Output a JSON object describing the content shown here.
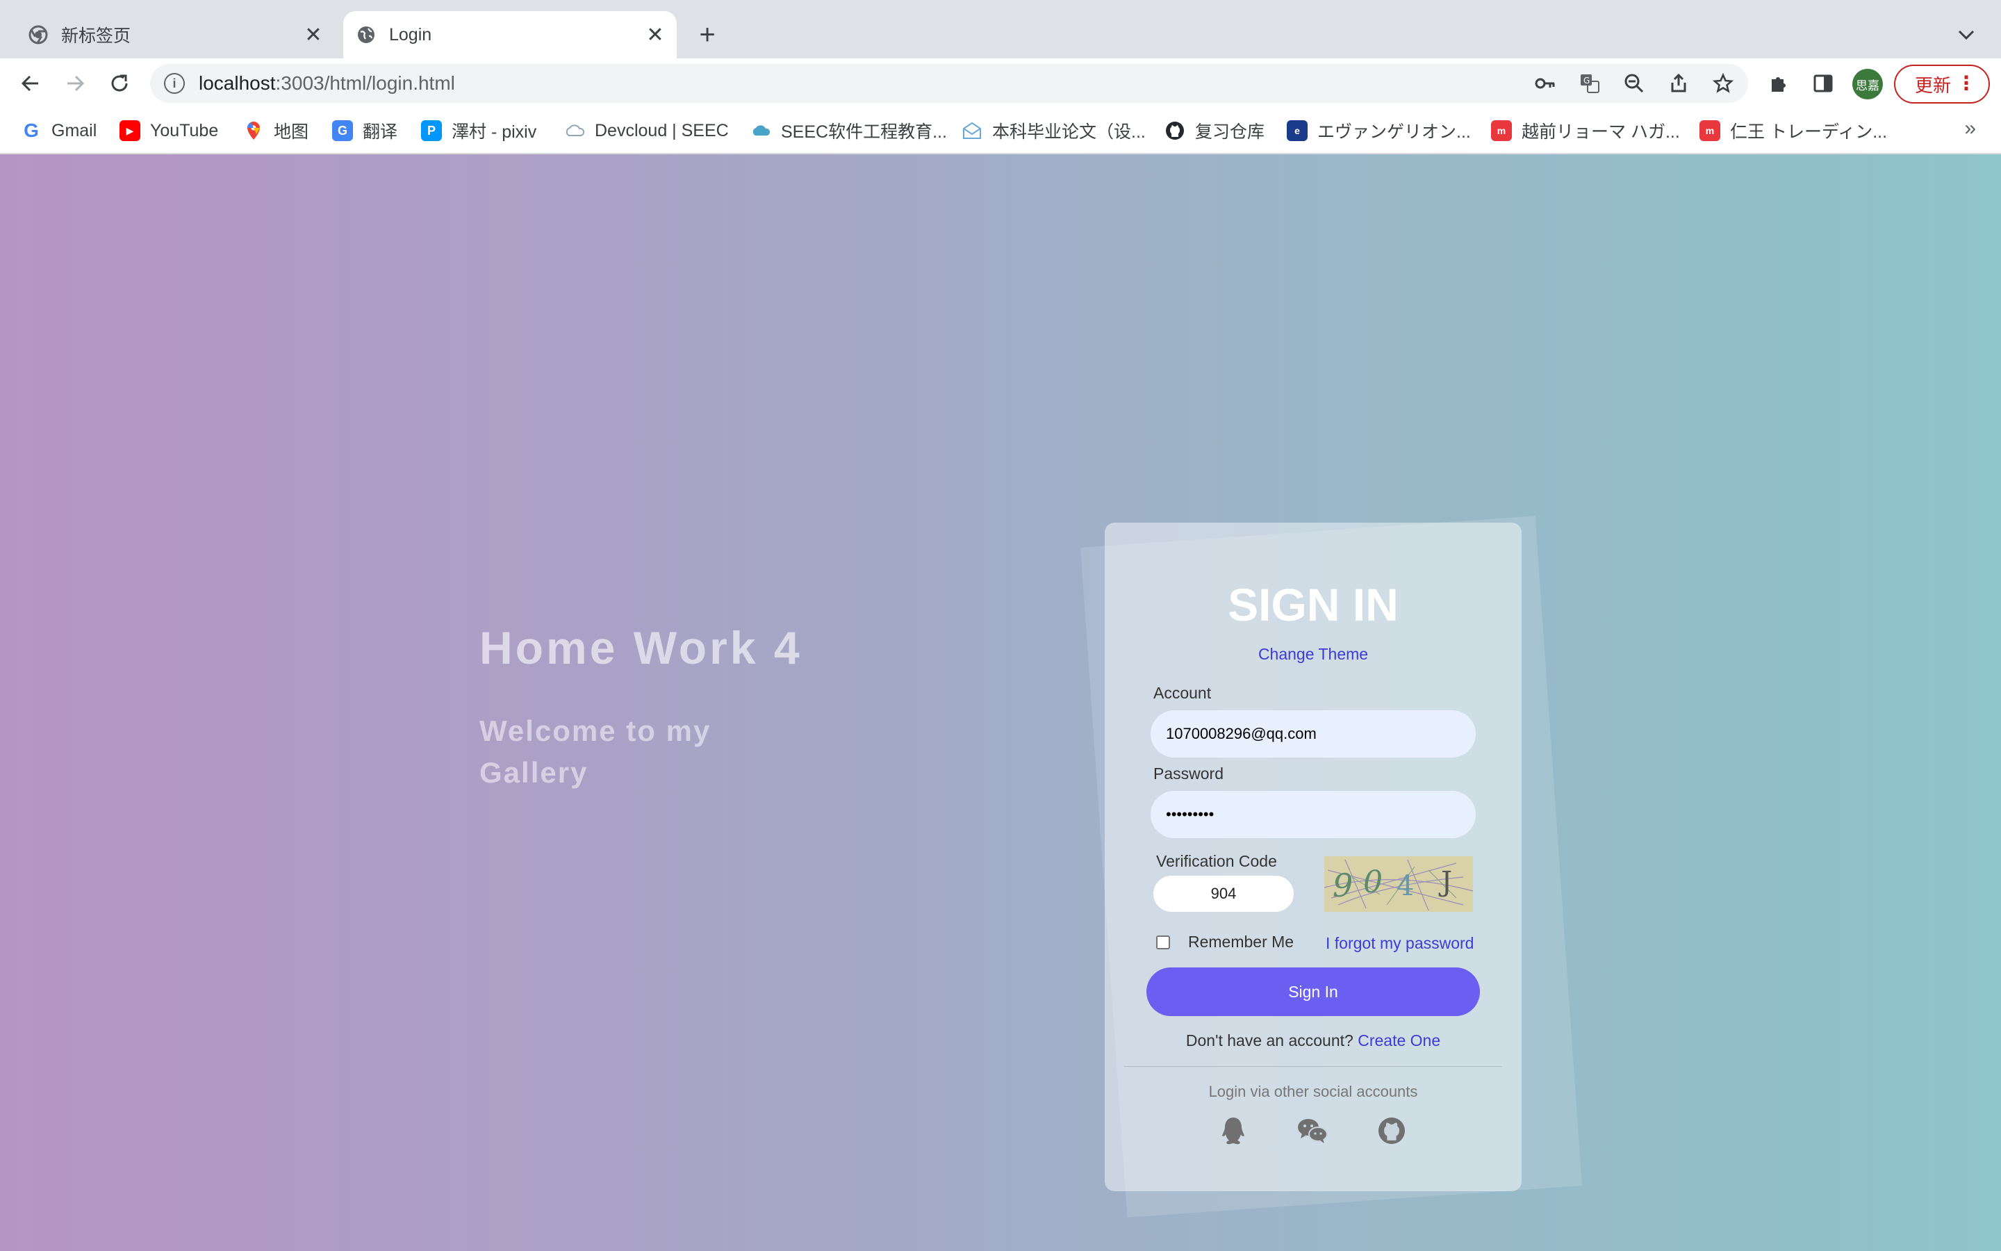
{
  "browser": {
    "tabs": [
      {
        "title": "新标签页",
        "icon": "chrome-icon",
        "active": false
      },
      {
        "title": "Login",
        "icon": "globe-icon",
        "active": true
      }
    ],
    "url_host": "localhost",
    "url_path": ":3003/html/login.html",
    "avatar_text": "思嘉",
    "update_label": "更新",
    "bookmarks": [
      {
        "label": "Gmail",
        "icon": "google-icon"
      },
      {
        "label": "YouTube",
        "icon": "youtube-icon"
      },
      {
        "label": "地图",
        "icon": "maps-icon"
      },
      {
        "label": "翻译",
        "icon": "translate-icon"
      },
      {
        "label": "澤村 - pixiv",
        "icon": "pixiv-icon"
      },
      {
        "label": "Devcloud | SEEC",
        "icon": "cloud-icon"
      },
      {
        "label": "SEEC软件工程教育...",
        "icon": "cloud-icon"
      },
      {
        "label": "本科毕业论文（设...",
        "icon": "mail-icon"
      },
      {
        "label": "复习仓库",
        "icon": "github-icon"
      },
      {
        "label": "エヴァンゲリオン...",
        "icon": "site-icon"
      },
      {
        "label": "越前リョーマ ハガ...",
        "icon": "shop-icon"
      },
      {
        "label": "仁王 トレーディン...",
        "icon": "shop-icon"
      }
    ],
    "more_label": "»"
  },
  "page": {
    "hero_title": "Home Work 4",
    "hero_subtitle": "Welcome to my Gallery"
  },
  "login": {
    "title": "SIGN IN",
    "change_theme": "Change Theme",
    "account_label": "Account",
    "account_value": "1070008296@qq.com",
    "password_label": "Password",
    "password_value": "•••••••••",
    "code_label": "Verification Code",
    "code_value": "904",
    "captcha_text": "904J",
    "remember_label": "Remember Me",
    "forgot_label": "I forgot my password",
    "signin_label": "Sign In",
    "no_account_text": "Don't have an account?",
    "create_label": "Create One",
    "social_title": "Login via other social accounts",
    "social": [
      "qq-icon",
      "wechat-icon",
      "github-icon"
    ]
  },
  "colors": {
    "accent": "#6a5ff0",
    "link": "#3d3bd8",
    "gradient_left": "#b695c3",
    "gradient_right": "#8ec4cb",
    "update": "#c5221f"
  }
}
